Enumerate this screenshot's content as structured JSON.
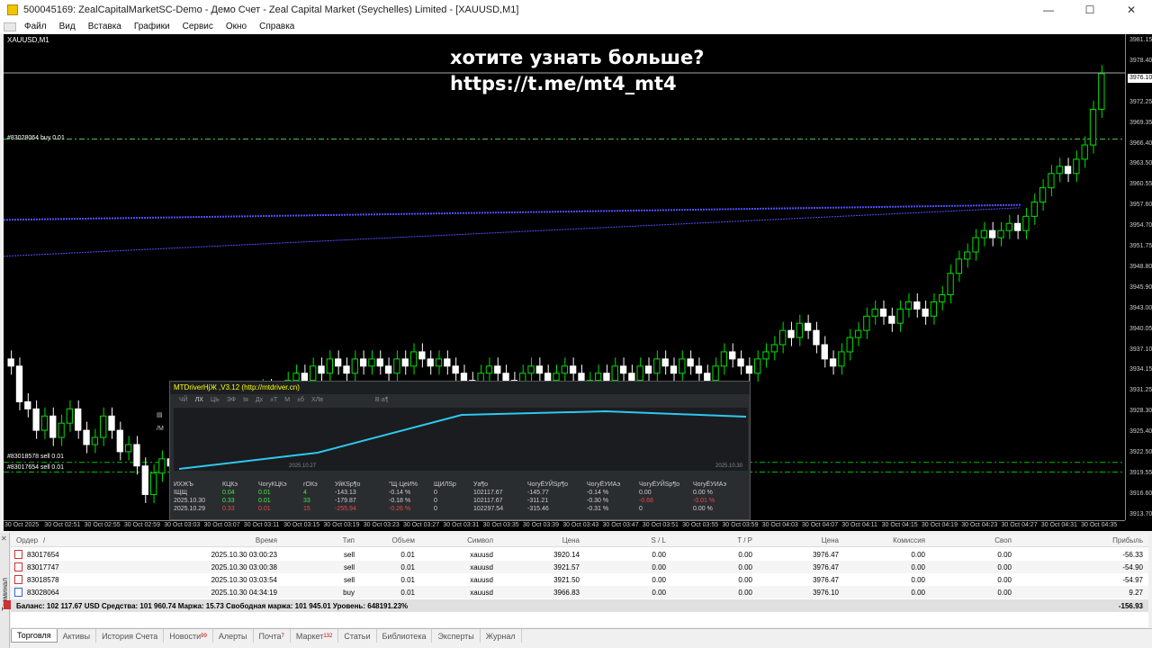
{
  "window": {
    "title": "500045169: ZealCapitalMarketSC-Demo - Демо Счет - Zeal Capital Market (Seychelles) Limited - [XAUUSD,M1]",
    "min": "—",
    "max": "☐",
    "close": "✕"
  },
  "menu": [
    "Файл",
    "Вид",
    "Вставка",
    "Графики",
    "Сервис",
    "Окно",
    "Справка"
  ],
  "chart": {
    "symbol": "XAUUSD,M1",
    "overlay_line1": "хотите узнать больше?",
    "overlay_line2": "https://t.me/mt4_mt4",
    "price_labels": [
      "3981.15",
      "3978.40",
      "3975.20",
      "3972.25",
      "3969.35",
      "3966.40",
      "3963.50",
      "3960.55",
      "3957.60",
      "3954.70",
      "3951.75",
      "3948.80",
      "3945.90",
      "3943.00",
      "3940.05",
      "3937.10",
      "3934.15",
      "3931.25",
      "3928.30",
      "3925.40",
      "3922.50",
      "3919.55",
      "3916.60",
      "3913.70"
    ],
    "current_price": "3976.10",
    "time_labels": [
      "30 Oct 2025",
      "30 Oct 02:51",
      "30 Oct 02:55",
      "30 Oct 02:59",
      "30 Oct 03:03",
      "30 Oct 03:07",
      "30 Oct 03:11",
      "30 Oct 03:15",
      "30 Oct 03:19",
      "30 Oct 03:23",
      "30 Oct 03:27",
      "30 Oct 03:31",
      "30 Oct 03:35",
      "30 Oct 03:39",
      "30 Oct 03:43",
      "30 Oct 03:47",
      "30 Oct 03:51",
      "30 Oct 03:55",
      "30 Oct 03:59",
      "30 Oct 04:03",
      "30 Oct 04:07",
      "30 Oct 04:11",
      "30 Oct 04:15",
      "30 Oct 04:19",
      "30 Oct 04:23",
      "30 Oct 04:27",
      "30 Oct 04:31",
      "30 Oct 04:35"
    ],
    "order_lines": [
      {
        "label": "#83028064 buy 0.01"
      },
      {
        "label": "#83018578 sell 0.01"
      },
      {
        "label": "#83017654 sell 0.01"
      }
    ],
    "colors": {
      "bull": "#00e000",
      "bear": "#ffffff",
      "grid": "#00c000",
      "buy_line": "#50c050",
      "ma": "#5050ff"
    }
  },
  "ea_panel": {
    "title": "MTDriverHjЖ ,V3.12 (http://mtdriver.cn)",
    "tabs": [
      "ЧЙ",
      "ЛХ",
      "ЦЬ",
      "ЭФ",
      "Ія",
      "Дх",
      "±Т",
      "М",
      "±б",
      "ХЛв",
      "В·а¶"
    ],
    "graph_date_left": "2025.10.27",
    "graph_date_right": "2025.10.30",
    "table_headers": [
      "ИХЖЪ",
      "КЦКэ",
      "ЧогуКЦКэ",
      "гОКэ",
      "УйКЅр¶о",
      "°Щ·ЦеИ%",
      "ЩИЛЅр",
      "Уа¶о",
      "ЧогуЁУЙЅр¶о",
      "ЧогуЁУИАэ",
      "ЧогуЁУЙЅр¶о",
      "ЧогуЁУИАэ"
    ],
    "rows": [
      {
        "c": [
          "ІЩЩ",
          "0.04",
          "0.01",
          "4",
          "-143.13",
          "-0.14 %",
          "0",
          "102117.67",
          "-145.77",
          "-0.14 %",
          "0.00",
          "0.00 %"
        ]
      },
      {
        "c": [
          "2025.10.30",
          "0.33",
          "0.01",
          "33",
          "-179.87",
          "-0.18 %",
          "0",
          "102117.67",
          "-311.21",
          "-0.30 %",
          "-0.68",
          "-0.01 %"
        ]
      },
      {
        "c": [
          "2025.10.29",
          "0.33",
          "0.01",
          "15",
          "-255.94",
          "-0.26 %",
          "0",
          "102297.54",
          "-315.46",
          "-0.31 %",
          "0",
          "0.00 %"
        ]
      }
    ]
  },
  "trade": {
    "headers": {
      "order": "Ордер",
      "sort": "/",
      "time": "Время",
      "type": "Тип",
      "volume": "Объем",
      "symbol": "Символ",
      "price": "Цена",
      "sl": "S / L",
      "tp": "T / P",
      "cur_price": "Цена",
      "commission": "Комиссия",
      "swap": "Своп",
      "profit": "Прибыль"
    },
    "rows": [
      {
        "order": "83017654",
        "time": "2025.10.30 03:00:23",
        "type": "sell",
        "volume": "0.01",
        "symbol": "xauusd",
        "price": "3920.14",
        "sl": "0.00",
        "tp": "0.00",
        "cur_price": "3976.47",
        "commission": "0.00",
        "swap": "0.00",
        "profit": "-56.33"
      },
      {
        "order": "83017747",
        "time": "2025.10.30 03:00:38",
        "type": "sell",
        "volume": "0.01",
        "symbol": "xauusd",
        "price": "3921.57",
        "sl": "0.00",
        "tp": "0.00",
        "cur_price": "3976.47",
        "commission": "0.00",
        "swap": "0.00",
        "profit": "-54.90"
      },
      {
        "order": "83018578",
        "time": "2025.10.30 03:03:54",
        "type": "sell",
        "volume": "0.01",
        "symbol": "xauusd",
        "price": "3921.50",
        "sl": "0.00",
        "tp": "0.00",
        "cur_price": "3976.47",
        "commission": "0.00",
        "swap": "0.00",
        "profit": "-54.97"
      },
      {
        "order": "83028064",
        "time": "2025.10.30 04:34:19",
        "type": "buy",
        "volume": "0.01",
        "symbol": "xauusd",
        "price": "3966.83",
        "sl": "0.00",
        "tp": "0.00",
        "cur_price": "3976.10",
        "commission": "0.00",
        "swap": "0.00",
        "profit": "9.27"
      }
    ],
    "balance_text": "Баланс: 102 117.67 USD  Средства: 101 960.74  Маржа: 15.73  Свободная маржа: 101 945.01  Уровень: 648191.23%",
    "total_profit": "-156.93"
  },
  "terminal_label": "Терминал",
  "tabs": [
    {
      "label": "Торговля",
      "badge": ""
    },
    {
      "label": "Активы",
      "badge": ""
    },
    {
      "label": "История Счета",
      "badge": ""
    },
    {
      "label": "Новости",
      "badge": "99"
    },
    {
      "label": "Алерты",
      "badge": ""
    },
    {
      "label": "Почта",
      "badge": "7"
    },
    {
      "label": "Маркет",
      "badge": "132"
    },
    {
      "label": "Статьи",
      "badge": ""
    },
    {
      "label": "Библиотека",
      "badge": ""
    },
    {
      "label": "Эксперты",
      "badge": ""
    },
    {
      "label": "Журнал",
      "badge": ""
    }
  ]
}
